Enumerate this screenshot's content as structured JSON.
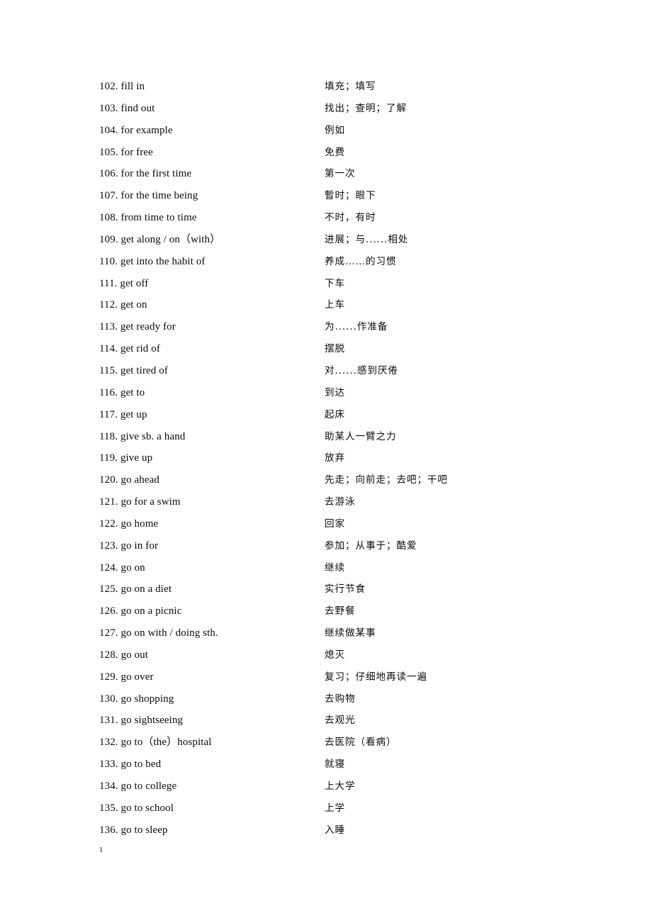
{
  "document": {
    "page_number": "1",
    "entries": [
      {
        "number": "102.",
        "english": "fill in",
        "chinese": "填充；填写"
      },
      {
        "number": "103.",
        "english": "find out",
        "chinese": "找出；查明；了解"
      },
      {
        "number": "104.",
        "english": "for example",
        "chinese": "例如"
      },
      {
        "number": "105.",
        "english": "for free",
        "chinese": "免费"
      },
      {
        "number": "106.",
        "english": "for the first time",
        "chinese": "第一次"
      },
      {
        "number": "107.",
        "english": "for the time being",
        "chinese": "暫时；眼下"
      },
      {
        "number": "108.",
        "english": "from time to time",
        "chinese": "不时，有时"
      },
      {
        "number": "109.",
        "english": "get along / on（with）",
        "chinese": "进展；与......相处"
      },
      {
        "number": "110.",
        "english": "get into the habit of",
        "chinese": "养成……的习惯"
      },
      {
        "number": "111.",
        "english": "get off",
        "chinese": "下车"
      },
      {
        "number": "112.",
        "english": "get on",
        "chinese": "上车"
      },
      {
        "number": "113.",
        "english": "get ready for",
        "chinese": "为......作准备"
      },
      {
        "number": "114.",
        "english": "get rid of",
        "chinese": "摆脱"
      },
      {
        "number": "115.",
        "english": "get tired of",
        "chinese": "对......感到厌倦"
      },
      {
        "number": "116.",
        "english": "get to",
        "chinese": "到达"
      },
      {
        "number": "117.",
        "english": "get up",
        "chinese": "起床"
      },
      {
        "number": "118.",
        "english": "give sb. a hand",
        "chinese": "助某人一臂之力"
      },
      {
        "number": "119.",
        "english": "give up",
        "chinese": "放弃"
      },
      {
        "number": "120.",
        "english": "go ahead",
        "chinese": "先走；向前走；去吧；干吧"
      },
      {
        "number": "121.",
        "english": "go for a swim",
        "chinese": "去游泳"
      },
      {
        "number": "122.",
        "english": "go home",
        "chinese": "回家"
      },
      {
        "number": "123.",
        "english": "go in for",
        "chinese": "参加；从事于；酷爱"
      },
      {
        "number": "124.",
        "english": "go on",
        "chinese": "继续"
      },
      {
        "number": "125.",
        "english": "go on a diet",
        "chinese": "实行节食"
      },
      {
        "number": "126.",
        "english": "go on a picnic",
        "chinese": "去野餐"
      },
      {
        "number": "127.",
        "english": "go on with / doing sth.",
        "chinese": "继续做某事"
      },
      {
        "number": "128.",
        "english": "go out",
        "chinese": "熄灭"
      },
      {
        "number": "129.",
        "english": "go over",
        "chinese": "复习；仔细地再读一遍"
      },
      {
        "number": "130.",
        "english": "go shopping",
        "chinese": "去购物"
      },
      {
        "number": "131.",
        "english": "go sightseeing",
        "chinese": "去观光"
      },
      {
        "number": "132.",
        "english": "go to（the）hospital",
        "chinese": "去医院（看病）"
      },
      {
        "number": "133.",
        "english": "go to bed",
        "chinese": "就寝"
      },
      {
        "number": "134.",
        "english": "go to college",
        "chinese": "上大学"
      },
      {
        "number": "135.",
        "english": "go to school",
        "chinese": "上学"
      },
      {
        "number": "136.",
        "english": "go to sleep",
        "chinese": "入睡"
      }
    ]
  }
}
